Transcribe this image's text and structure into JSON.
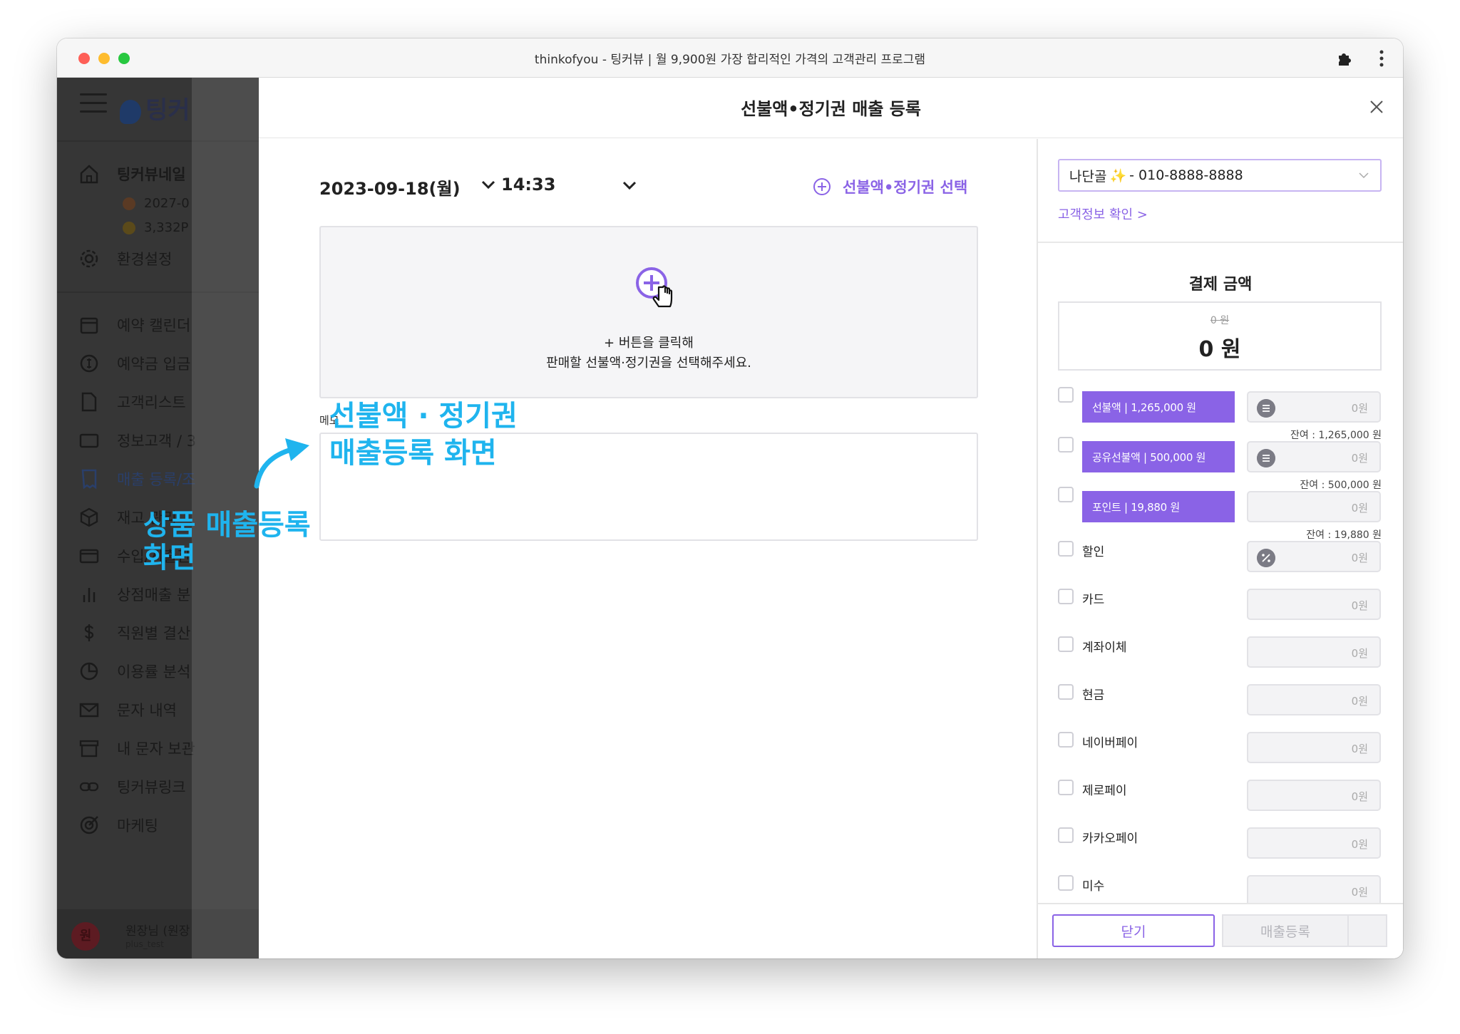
{
  "window": {
    "title": "thinkofyou - 팅커뷰 | 월 9,900원 가장 합리적인 가격의 고객관리 프로그램",
    "icons": [
      "puzzle-icon",
      "more-icon"
    ]
  },
  "sidebar": {
    "logo": "팅커",
    "shop": "팅커뷰네일",
    "sub_items": [
      "2027-0",
      "3,332P"
    ],
    "items": [
      {
        "label": "환경설정",
        "icon": "gear-icon"
      },
      {
        "label": "예약 캘린더",
        "icon": "calendar-icon"
      },
      {
        "label": "예약금 입금",
        "icon": "coin-icon"
      },
      {
        "label": "고객리스트",
        "icon": "document-icon"
      },
      {
        "label": "정보고객 / 3",
        "icon": "card-icon"
      },
      {
        "label": "매출 등록/조",
        "icon": "receipt-icon"
      },
      {
        "label": "재고 관리",
        "icon": "box-icon"
      },
      {
        "label": "수입/지출관",
        "icon": "wallet-icon"
      },
      {
        "label": "상점매출 분",
        "icon": "chart-icon"
      },
      {
        "label": "직원별 결산",
        "icon": "dollar-icon"
      },
      {
        "label": "이용률 분석",
        "icon": "pie-icon"
      },
      {
        "label": "문자 내역",
        "icon": "mail-icon"
      },
      {
        "label": "내 문자 보관",
        "icon": "archive-icon"
      },
      {
        "label": "팅커뷰링크",
        "icon": "link-icon"
      },
      {
        "label": "마케팅",
        "icon": "target-icon"
      }
    ],
    "user": {
      "avatar": "원",
      "name": "원장님 (원장",
      "id": "plus_test"
    }
  },
  "modal": {
    "title": "선불액•정기권 매출 등록",
    "date": "2023-09-18(월)",
    "time": "14:33",
    "select_link": "선불액•정기권 선택",
    "empty_line1": "+ 버튼을 클릭해",
    "empty_line2": "판매할 선불액·정기권을 선택해주세요.",
    "memo_label": "메모",
    "memo_value": ""
  },
  "payment": {
    "customer_name": "나단골",
    "customer_phone": "- 010-8888-8888",
    "customer_link": "고객정보 확인 >",
    "title": "결제 금액",
    "old_amount": "0 원",
    "amount": "0 원",
    "products": [
      {
        "label": "선불액 | 1,265,000 원",
        "value": "0원",
        "balance": "잔여 : 1,265,000 원",
        "checked": false
      },
      {
        "label": "공유선불액 | 500,000 원",
        "value": "0원",
        "balance": "잔여 : 500,000 원",
        "checked": false
      },
      {
        "label": "포인트 | 19,880 원",
        "value": "0원",
        "balance": "잔여 : 19,880 원",
        "checked": false
      }
    ],
    "methods": [
      {
        "label": "할인",
        "value": "0원"
      },
      {
        "label": "카드",
        "value": "0원"
      },
      {
        "label": "계좌이체",
        "value": "0원"
      },
      {
        "label": "현금",
        "value": "0원"
      },
      {
        "label": "네이버페이",
        "value": "0원"
      },
      {
        "label": "제로페이",
        "value": "0원"
      },
      {
        "label": "카카오페이",
        "value": "0원"
      },
      {
        "label": "미수",
        "value": "0원"
      }
    ],
    "close_label": "닫기",
    "submit_label": "매출등록"
  },
  "annotations": {
    "prepaid_line1": "선불액 · 정기권",
    "prepaid_line2": "매출등록 화면",
    "product_line1": "상품 매출등록",
    "product_line2": "화면",
    "color": "#1fb4ee"
  },
  "colors": {
    "accent": "#8a63e6"
  }
}
